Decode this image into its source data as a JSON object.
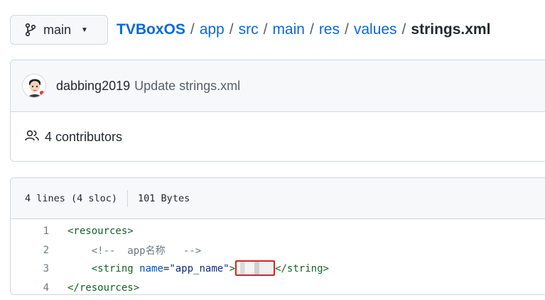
{
  "branch": {
    "label": "main"
  },
  "breadcrumb": {
    "items": [
      "TVBoxOS",
      "app",
      "src",
      "main",
      "res",
      "values"
    ],
    "separator": "/",
    "current": "strings.xml"
  },
  "commit": {
    "author": "dabbing2019",
    "message": "Update strings.xml"
  },
  "contributors": {
    "text": "4 contributors"
  },
  "file_info": {
    "lines": "4 lines (4 sloc)",
    "size": "101 Bytes"
  },
  "code": {
    "line_numbers": [
      "1",
      "2",
      "3",
      "4"
    ],
    "line1": "<resources>",
    "line2_comment": "<!--  app名称   -->",
    "line3_open": "<string",
    "line3_attr": "name",
    "line3_eq": "=",
    "line3_value": "\"app_name\"",
    "line3_gt": ">",
    "line3_close": "</string>",
    "line4": "</resources>"
  },
  "colors": {
    "link": "#0969da",
    "highlight_border": "#e0201b",
    "header_bg": "#f6f8fa"
  },
  "icons": {
    "branch": "git-branch-icon",
    "caret": "triangle-down-icon",
    "contributors": "people-icon"
  }
}
